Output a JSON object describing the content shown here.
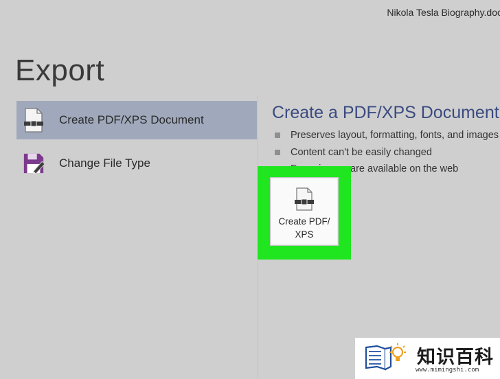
{
  "window": {
    "doc_title": "Nikola Tesla Biography.docx"
  },
  "page": {
    "title": "Export"
  },
  "left_menu": {
    "items": [
      {
        "label": "Create PDF/XPS Document",
        "icon": "pdf-document-icon",
        "selected": true
      },
      {
        "label": "Change File Type",
        "icon": "save-file-type-icon",
        "selected": false
      }
    ]
  },
  "details": {
    "title": "Create a PDF/XPS Document",
    "bullets": [
      "Preserves layout, formatting, fonts, and images",
      "Content can't be easily changed",
      "Free viewers are available on the web"
    ]
  },
  "action": {
    "line1": "Create PDF/",
    "line2": "XPS",
    "highlight_color": "#1fe61f"
  },
  "watermark": {
    "brand": "知识百科",
    "url": "www.mimingshi.com"
  },
  "colors": {
    "background": "#cfcfcf",
    "selected_item": "#a0a9bc",
    "title_blue": "#3a4a80",
    "save_purple": "#7b3b8c"
  }
}
